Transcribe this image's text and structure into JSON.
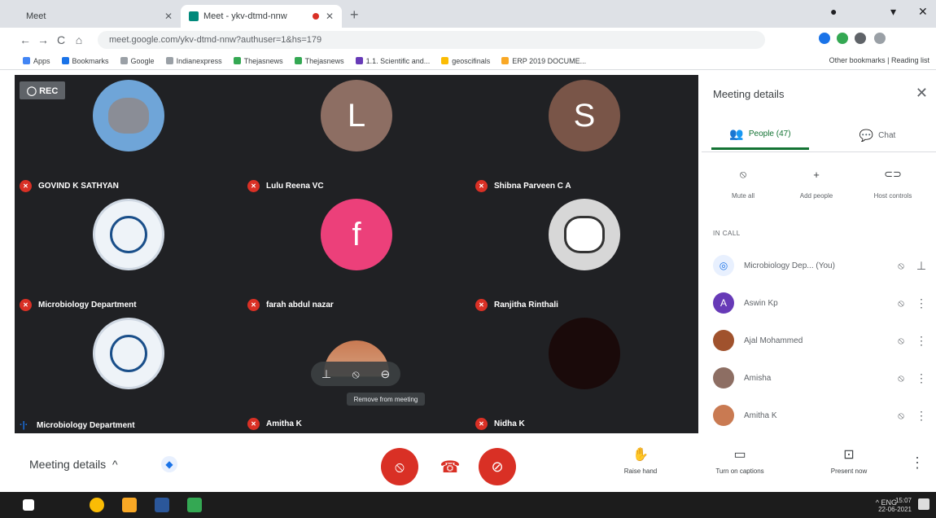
{
  "browser": {
    "tabs": [
      {
        "label": "Meet",
        "active": false
      },
      {
        "label": "Meet - ykv-dtmd-nnw",
        "active": true
      }
    ],
    "new_tab": "+",
    "url": "meet.google.com/ykv-dtmd-nnw?authuser=1&hs=179",
    "nav": {
      "back": "←",
      "forward": "→",
      "reload": "C",
      "home": "⌂"
    },
    "bookmarks": [
      "Apps",
      "Bookmarks",
      "Google",
      "Indianexpress",
      "Thejasnews",
      "Thejasnews",
      "1.1. Scientific and...",
      "geoscifinals",
      "ERP 2019 DOCUME..."
    ],
    "bookmarks_right": "Other bookmarks  |  Reading list",
    "window_controls": [
      "●",
      "▾",
      "✕"
    ]
  },
  "stage": {
    "rec_label": "◯ REC",
    "tiles": [
      {
        "name": "GOVIND K SATHYAN",
        "avatar_type": "cartoon",
        "letter": "",
        "color": "#6fa5d8",
        "muted": true
      },
      {
        "name": "Lulu Reena VC",
        "avatar_type": "letter",
        "letter": "L",
        "color": "#8d6e63",
        "muted": true
      },
      {
        "name": "Shibna Parveen C A",
        "avatar_type": "letter",
        "letter": "S",
        "color": "#795548",
        "muted": true
      },
      {
        "name": "Microbiology Department",
        "avatar_type": "logo",
        "letter": "",
        "color": "#eef3f8",
        "muted": true
      },
      {
        "name": "farah abdul nazar",
        "avatar_type": "letter",
        "letter": "f",
        "color": "#ec407a",
        "muted": true
      },
      {
        "name": "Ranjitha Rinthali",
        "avatar_type": "sketch",
        "letter": "",
        "color": "#d7d7d7",
        "muted": true
      },
      {
        "name": "Microbiology Department",
        "avatar_type": "logo",
        "letter": "",
        "color": "#eef3f8",
        "muted": false
      },
      {
        "name": "Amitha K",
        "avatar_type": "photo",
        "letter": "",
        "color": "#c97a52",
        "muted": true
      },
      {
        "name": "Nidha K",
        "avatar_type": "dark",
        "letter": "",
        "color": "#1a0a0a",
        "muted": true
      }
    ],
    "hover_controls": {
      "pin": "📌",
      "mute": "🎙",
      "remove": "⊖"
    },
    "tooltip": "Remove from meeting"
  },
  "panel": {
    "title": "Meeting details",
    "close": "✕",
    "tab_people": "People (47)",
    "tab_chat": "Chat",
    "actions": [
      {
        "label": "Mute all",
        "icon": "mic-off"
      },
      {
        "label": "Add people",
        "icon": "add-person"
      },
      {
        "label": "Host controls",
        "icon": "toggle"
      }
    ],
    "section_label": "IN CALL",
    "participants": [
      {
        "name": "Microbiology Dep... (You)",
        "initial": "",
        "color": "#e8f0fe",
        "pinned": true
      },
      {
        "name": "Aswin Kp",
        "initial": "A",
        "color": "#673ab7",
        "pinned": false
      },
      {
        "name": "Ajal Mohammed",
        "initial": "",
        "color": "#a0522d",
        "pinned": false
      },
      {
        "name": "Amisha",
        "initial": "",
        "color": "#8d6e63",
        "pinned": false
      },
      {
        "name": "Amitha K",
        "initial": "",
        "color": "#c97a52",
        "pinned": false
      }
    ]
  },
  "bottom": {
    "meeting_details": "Meeting details",
    "chevron": "^",
    "raise_hand": "Raise hand",
    "captions": "Turn on captions",
    "present": "Present now"
  },
  "taskbar": {
    "tray_text": "^  ENG",
    "time": "15:07",
    "date": "22-06-2021"
  },
  "colors": {
    "stage_bg": "#202124",
    "danger": "#d93025",
    "accent_green": "#137333"
  }
}
